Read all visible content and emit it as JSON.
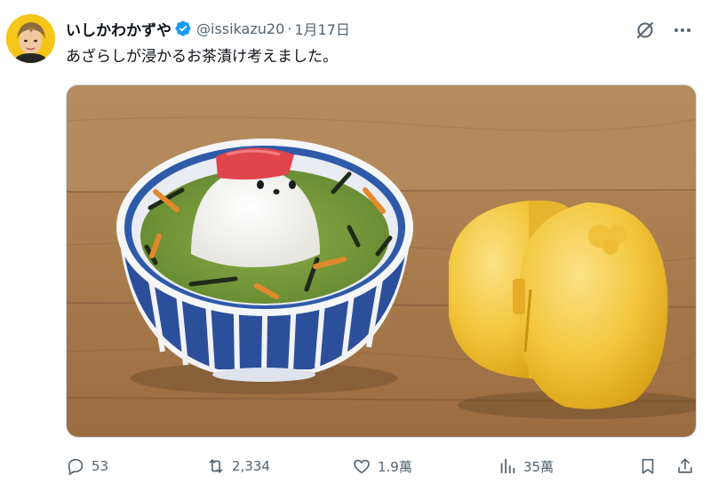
{
  "author": {
    "display_name": "いしかわかずや",
    "handle": "@issikazu20",
    "separator": "·",
    "date": "1月17日"
  },
  "tweet": {
    "text": "あざらしが浸かるお茶漬け考えました。"
  },
  "media": {
    "alt_subject": "seal-shaped rice in green tea bowl with yellow seal mold"
  },
  "actions": {
    "replies": "53",
    "retweets": "2,334",
    "likes": "1.9萬",
    "views": "35萬"
  },
  "icons": {
    "verified": "verified-badge-icon",
    "grok": "grok-icon",
    "more": "more-icon",
    "reply": "reply-icon",
    "retweet": "retweet-icon",
    "like": "heart-icon",
    "views": "views-icon",
    "bookmark": "bookmark-icon",
    "share": "share-icon"
  },
  "colors": {
    "text_primary": "#0f1419",
    "text_secondary": "#536471",
    "verified": "#1d9bf0",
    "border": "#cfd9de"
  }
}
